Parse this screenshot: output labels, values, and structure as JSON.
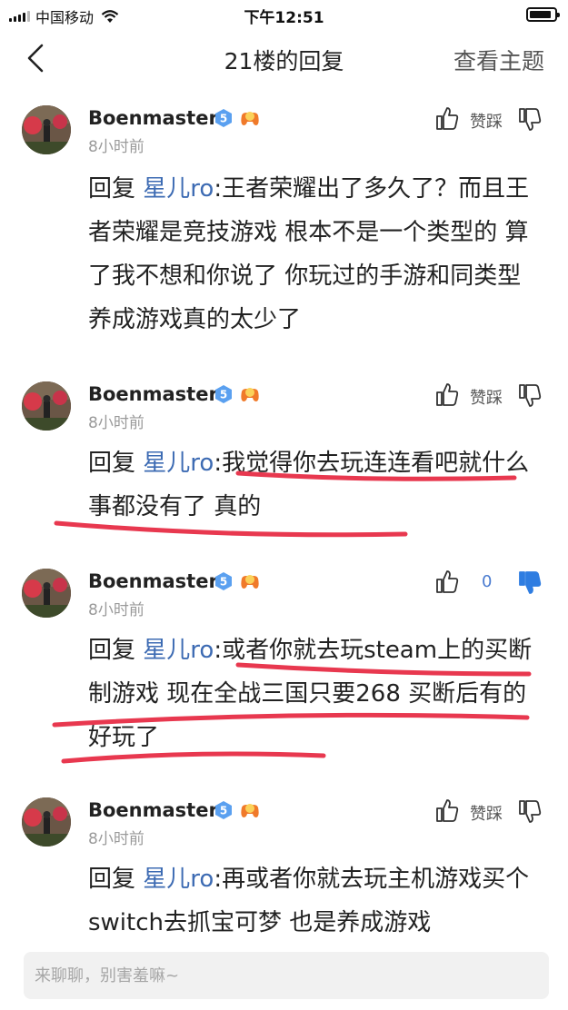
{
  "status_bar": {
    "carrier": "中国移动",
    "time": "下午12:51",
    "battery_level": 0.9
  },
  "nav": {
    "title": "21楼的回复",
    "right_action": "查看主题"
  },
  "posts": [
    {
      "username": "Boenmaster",
      "level": "5",
      "time": "8小时前",
      "vote_label": "赞踩",
      "reply_prefix": "回复",
      "reply_to": "星儿ro",
      "text": ":王者荣耀出了多久了？而且王者荣耀是竞技游戏 根本不是一个类型的 算了我不想和你说了 你玩过的手游和同类型养成游戏真的太少了",
      "downvoted": false
    },
    {
      "username": "Boenmaster",
      "level": "5",
      "time": "8小时前",
      "vote_label": "赞踩",
      "reply_prefix": "回复",
      "reply_to": "星儿ro",
      "text": ":我觉得你去玩连连看吧就什么事都没有了 真的",
      "downvoted": false
    },
    {
      "username": "Boenmaster",
      "level": "5",
      "time": "8小时前",
      "vote_label": "0",
      "reply_prefix": "回复",
      "reply_to": "星儿ro",
      "text": ":或者你就去玩steam上的买断制游戏 现在全战三国只要268 买断后有的好玩了",
      "downvoted": true
    },
    {
      "username": "Boenmaster",
      "level": "5",
      "time": "8小时前",
      "vote_label": "赞踩",
      "reply_prefix": "回复",
      "reply_to": "星儿ro",
      "text": ":再或者你就去玩主机游戏买个switch去抓宝可梦 也是养成游戏",
      "downvoted": false
    }
  ],
  "input": {
    "placeholder": "来聊聊，别害羞嘛~"
  },
  "colors": {
    "link": "#3d6bb3",
    "accent_blue": "#2f7de1",
    "marker_red": "#e8384f",
    "level_badge": "#5aa0f0"
  },
  "icons": [
    "back-arrow-icon",
    "thumbs-up-icon",
    "thumbs-down-icon",
    "level-badge-icon",
    "game-controller-icon",
    "wifi-icon",
    "battery-icon",
    "signal-icon"
  ]
}
